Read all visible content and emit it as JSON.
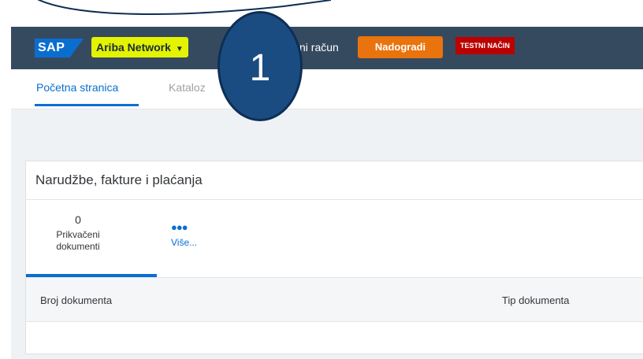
{
  "callout": {
    "number": "1"
  },
  "header": {
    "logo": "SAP",
    "app_name": "Ariba Network",
    "account_text": "ni račun",
    "upgrade_label": "Nadogradi",
    "test_badge": "TESTNI NAČIN",
    "colors": {
      "bar": "#354a5f",
      "highlight": "#e3f300",
      "upgrade": "#e9730c",
      "badge": "#bb0000",
      "callout": "#1a4c82"
    }
  },
  "tabs": [
    {
      "label": "Početna stranica",
      "active": true
    },
    {
      "label": "Kataloz",
      "active": false
    }
  ],
  "card": {
    "title": "Narudžbe, fakture i plaćanja",
    "tiles": {
      "attached": {
        "count": "0",
        "label_line1": "Prikvačeni",
        "label_line2": "dokumenti"
      },
      "more": {
        "dots": "●●●",
        "label": "Više..."
      }
    },
    "table": {
      "columns": [
        "Broj dokumenta",
        "Tip dokumenta"
      ]
    }
  }
}
